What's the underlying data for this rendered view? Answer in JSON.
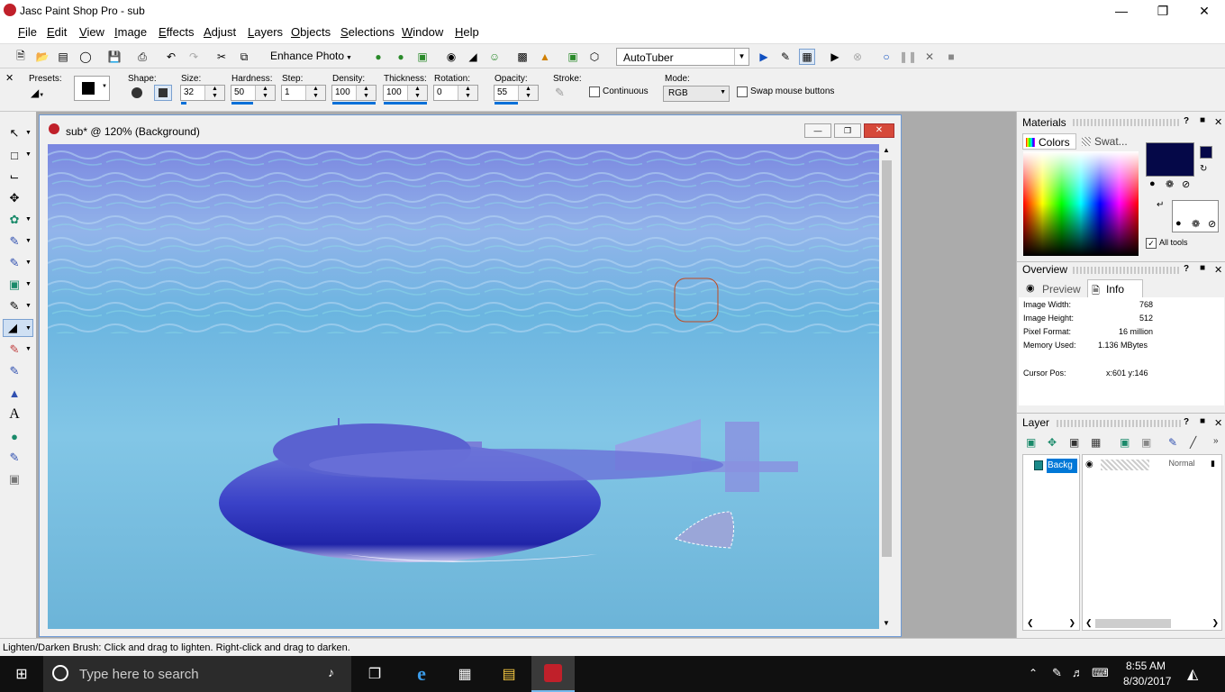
{
  "window": {
    "title": "Jasc Paint Shop Pro - sub"
  },
  "menu": [
    {
      "label": "File",
      "u": "F",
      "rest": "ile"
    },
    {
      "label": "Edit",
      "u": "E",
      "rest": "dit"
    },
    {
      "label": "View",
      "u": "V",
      "rest": "iew"
    },
    {
      "label": "Image",
      "u": "I",
      "rest": "mage"
    },
    {
      "label": "Effects",
      "u": "E",
      "rest": "ffects"
    },
    {
      "label": "Adjust",
      "u": "A",
      "rest": "djust"
    },
    {
      "label": "Layers",
      "u": "L",
      "rest": "ayers"
    },
    {
      "label": "Objects",
      "u": "O",
      "rest": "bjects"
    },
    {
      "label": "Selections",
      "u": "S",
      "rest": "elections"
    },
    {
      "label": "Window",
      "u": "W",
      "rest": "indow"
    },
    {
      "label": "Help",
      "u": "H",
      "rest": "elp"
    }
  ],
  "toolbar": {
    "enhance_photo": "Enhance Photo",
    "script_select": "AutoTuber"
  },
  "tool_options": {
    "presets_label": "Presets:",
    "shape_label": "Shape:",
    "size_label": "Size:",
    "size_value": "32",
    "hardness_label": "Hardness:",
    "hardness_value": "50",
    "step_label": "Step:",
    "step_value": "1",
    "density_label": "Density:",
    "density_value": "100",
    "thickness_label": "Thickness:",
    "thickness_value": "100",
    "rotation_label": "Rotation:",
    "rotation_value": "0",
    "opacity_label": "Opacity:",
    "opacity_value": "55",
    "stroke_label": "Stroke:",
    "continuous_label": "Continuous",
    "mode_label": "Mode:",
    "mode_value": "RGB",
    "swap_label": "Swap mouse buttons"
  },
  "document": {
    "title": "sub* @ 120% (Background)"
  },
  "materials": {
    "title": "Materials",
    "tab_colors": "Colors",
    "tab_swatches": "Swat...",
    "all_tools": "All tools",
    "foreground_color": "#050848",
    "background_color": "#050848"
  },
  "overview": {
    "title": "Overview",
    "tab_preview": "Preview",
    "tab_info": "Info",
    "rows": [
      {
        "label": "Image Width:",
        "value": "768"
      },
      {
        "label": "Image Height:",
        "value": "512"
      },
      {
        "label": "Pixel Format:",
        "value": "16 million"
      },
      {
        "label": "Memory Used:",
        "value": "1.136 MBytes"
      }
    ],
    "cursor_label": "Cursor Pos:",
    "cursor_value": "x:601 y:146"
  },
  "layer": {
    "title": "Layer",
    "layer_name": "Backg",
    "blend_mode": "Normal"
  },
  "status": {
    "text": "Lighten/Darken Brush: Click and drag to lighten. Right-click and drag to darken."
  },
  "taskbar": {
    "search_placeholder": "Type here to search",
    "time": "8:55 AM",
    "date": "8/30/2017"
  }
}
